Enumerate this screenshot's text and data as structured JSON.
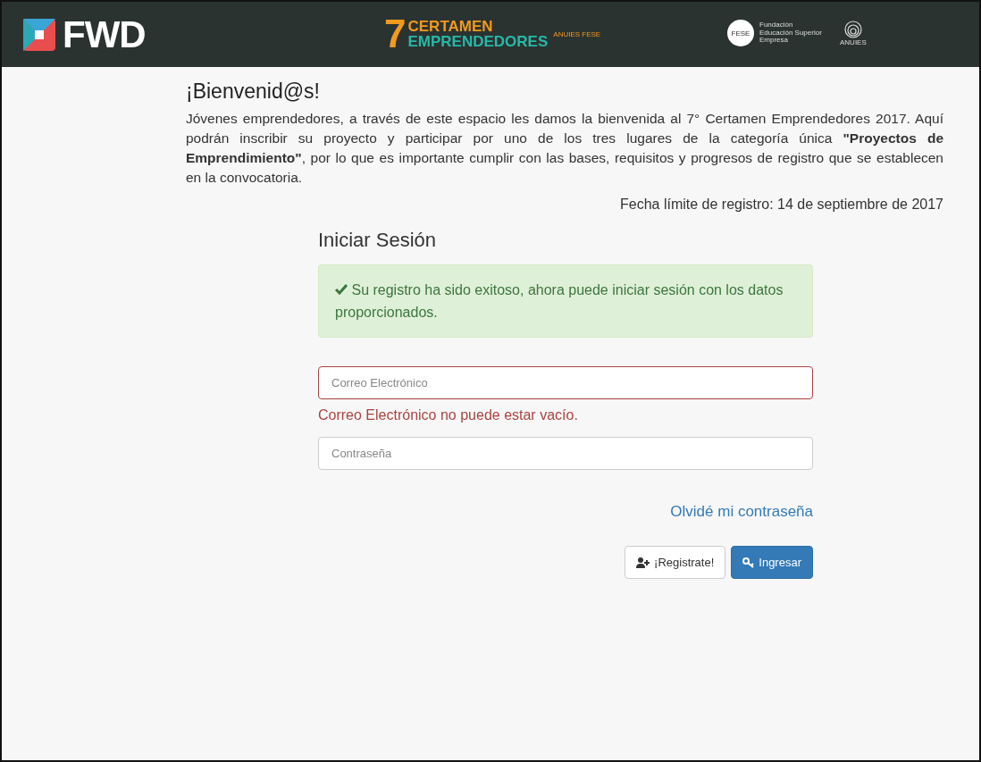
{
  "header": {
    "brand": "FWD",
    "event_number": "7",
    "event_line_1": "CERTAMEN",
    "event_line_2": "EMPRENDEDORES",
    "event_tag": "ANUIES FESE",
    "fese_badge": "FESE",
    "fese_name": "Fundación Educación Superior Empresa",
    "anuies": "ANUIES"
  },
  "welcome": {
    "title": "¡Bienvenid@s!",
    "text": "Jóvenes emprendedores, a través de este espacio les damos la bienvenida al 7° Certamen Emprendedores 2017. Aquí podrán inscribir su proyecto y participar por uno de los tres lugares de la categoría única **\"Proyectos de Emprendimiento\"**, por lo que es importante cumplir con las bases, requisitos y progresos de registro que se establecen en la convocatoria.",
    "deadline": "Fecha límite de registro: 14 de septiembre de 2017"
  },
  "login": {
    "title": "Iniciar Sesión",
    "alert": {
      "kind": "success",
      "text": "Su registro ha sido exitoso, ahora puede iniciar sesión con los datos proporcionados."
    },
    "fields": [
      {
        "placeholder": "Correo Electrónico",
        "invalid": true,
        "error": "Correo Electrónico no puede estar vacío."
      },
      {
        "placeholder": "Contraseña",
        "invalid": false
      }
    ],
    "forgot_link": "Olvidé mi contraseña",
    "buttons": [
      {
        "kind": "default",
        "label": "¡Registrate!"
      },
      {
        "kind": "primary",
        "label": "Ingresar"
      }
    ]
  }
}
